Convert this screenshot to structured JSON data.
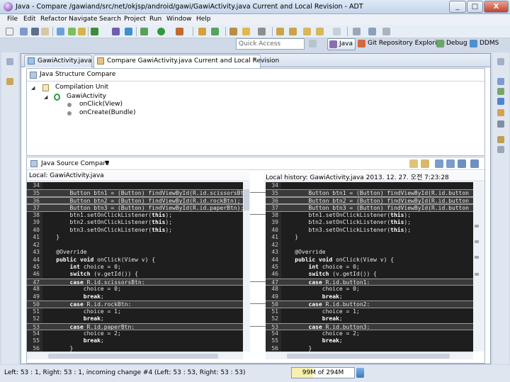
{
  "window": {
    "title": "Java - Compare /gawiand/src/net/okjsp/android/gawi/GawiActivity.java Current and Local Revision - ADT",
    "min": "_",
    "max": "□",
    "close": "X"
  },
  "menu": [
    "File",
    "Edit",
    "Refactor",
    "Navigate",
    "Search",
    "Project",
    "Run",
    "Window",
    "Help"
  ],
  "quick_access": {
    "placeholder": "Quick Access"
  },
  "perspectives": [
    {
      "label": "Java",
      "selected": true
    },
    {
      "label": "Git Repository Exploring"
    },
    {
      "label": "Debug"
    },
    {
      "label": "DDMS"
    }
  ],
  "tabs": [
    {
      "label": "GawiActivity.java",
      "active": false
    },
    {
      "label": "Compare GawiActivity.java Current and Local Revision",
      "active": true,
      "close": "✕"
    }
  ],
  "structure": {
    "title": "Java Structure Compare",
    "nodes": [
      "Compilation Unit",
      "GawiActivity",
      "onClick(View)",
      "onCreate(Bundle)"
    ]
  },
  "source": {
    "title": "Java Source Compare",
    "left_title": "Local: GawiActivity.java",
    "right_title": "Local history: GawiActivity.java 2013. 12. 27. 오전 7:23:28"
  },
  "left_lines": [
    {
      "n": "34",
      "t": "",
      "hl": false
    },
    {
      "n": "35",
      "t": "        Button btn1 = (Button) findViewById(R.id.scissorsBt",
      "hl": true
    },
    {
      "n": "36",
      "t": "        Button btn2 = (Button) findViewById(R.id.rockBtn);",
      "hl": true
    },
    {
      "n": "37",
      "t": "        Button btn3 = (Button) findViewById(R.id.paperBtn);",
      "hl": true
    },
    {
      "n": "38",
      "t": "        btn1.setOnClickListener(this);",
      "hl": false
    },
    {
      "n": "39",
      "t": "        btn2.setOnClickListener(this);",
      "hl": false
    },
    {
      "n": "40",
      "t": "        btn3.setOnClickListener(this);",
      "hl": false
    },
    {
      "n": "41",
      "t": "    }",
      "hl": false
    },
    {
      "n": "42",
      "t": "",
      "hl": false
    },
    {
      "n": "43",
      "t": "    @Override",
      "hl": false
    },
    {
      "n": "44",
      "t": "    public void onClick(View v) {",
      "hl": false
    },
    {
      "n": "45",
      "t": "        int choice = 0;",
      "hl": false
    },
    {
      "n": "46",
      "t": "        switch (v.getId()) {",
      "hl": false
    },
    {
      "n": "47",
      "t": "        case R.id.scissorsBtn:",
      "hl": true
    },
    {
      "n": "48",
      "t": "            choice = 0;",
      "hl": false
    },
    {
      "n": "49",
      "t": "            break;",
      "hl": false
    },
    {
      "n": "50",
      "t": "        case R.id.rockBtn:",
      "hl": true
    },
    {
      "n": "51",
      "t": "            choice = 1;",
      "hl": false
    },
    {
      "n": "52",
      "t": "            break;",
      "hl": false
    },
    {
      "n": "53",
      "t": "        case R.id.paperBtn:",
      "hl": true
    },
    {
      "n": "54",
      "t": "            choice = 2;",
      "hl": false
    },
    {
      "n": "55",
      "t": "            break;",
      "hl": false
    },
    {
      "n": "56",
      "t": "        }",
      "hl": false
    }
  ],
  "right_lines": [
    {
      "n": "34",
      "t": "",
      "hl": false
    },
    {
      "n": "35",
      "t": "        Button btn1 = (Button) findViewById(R.id.button",
      "hl": true
    },
    {
      "n": "36",
      "t": "        Button btn2 = (Button) findViewById(R.id.button",
      "hl": true
    },
    {
      "n": "37",
      "t": "        Button btn3 = (Button) findViewById(R.id.button",
      "hl": true
    },
    {
      "n": "38",
      "t": "        btn1.setOnClickListener(this);",
      "hl": false
    },
    {
      "n": "39",
      "t": "        btn2.setOnClickListener(this);",
      "hl": false
    },
    {
      "n": "40",
      "t": "        btn3.setOnClickListener(this);",
      "hl": false
    },
    {
      "n": "41",
      "t": "    }",
      "hl": false
    },
    {
      "n": "42",
      "t": "",
      "hl": false
    },
    {
      "n": "43",
      "t": "    @Override",
      "hl": false
    },
    {
      "n": "44",
      "t": "    public void onClick(View v) {",
      "hl": false
    },
    {
      "n": "45",
      "t": "        int choice = 0;",
      "hl": false
    },
    {
      "n": "46",
      "t": "        switch (v.getId()) {",
      "hl": false
    },
    {
      "n": "47",
      "t": "        case R.id.button1:",
      "hl": true
    },
    {
      "n": "48",
      "t": "            choice = 0;",
      "hl": false
    },
    {
      "n": "49",
      "t": "            break;",
      "hl": false
    },
    {
      "n": "50",
      "t": "        case R.id.button2:",
      "hl": true
    },
    {
      "n": "51",
      "t": "            choice = 1;",
      "hl": false
    },
    {
      "n": "52",
      "t": "            break;",
      "hl": false
    },
    {
      "n": "53",
      "t": "        case R.id.button3:",
      "hl": true
    },
    {
      "n": "54",
      "t": "            choice = 2;",
      "hl": false
    },
    {
      "n": "55",
      "t": "            break;",
      "hl": false
    },
    {
      "n": "56",
      "t": "        }",
      "hl": false
    }
  ],
  "keywords": [
    "public",
    "void",
    "int",
    "switch",
    "case",
    "break",
    "this"
  ],
  "status": {
    "text": "Left: 53 : 1, Right: 53 : 1, incoming change #4 (Left: 53 : 53, Right: 53 : 53)",
    "heap": "99M of 294M",
    "heap_fraction": 0.337
  },
  "colors": {
    "code_bg": "#1e1e1e",
    "change_line": "#9a9a9a"
  }
}
